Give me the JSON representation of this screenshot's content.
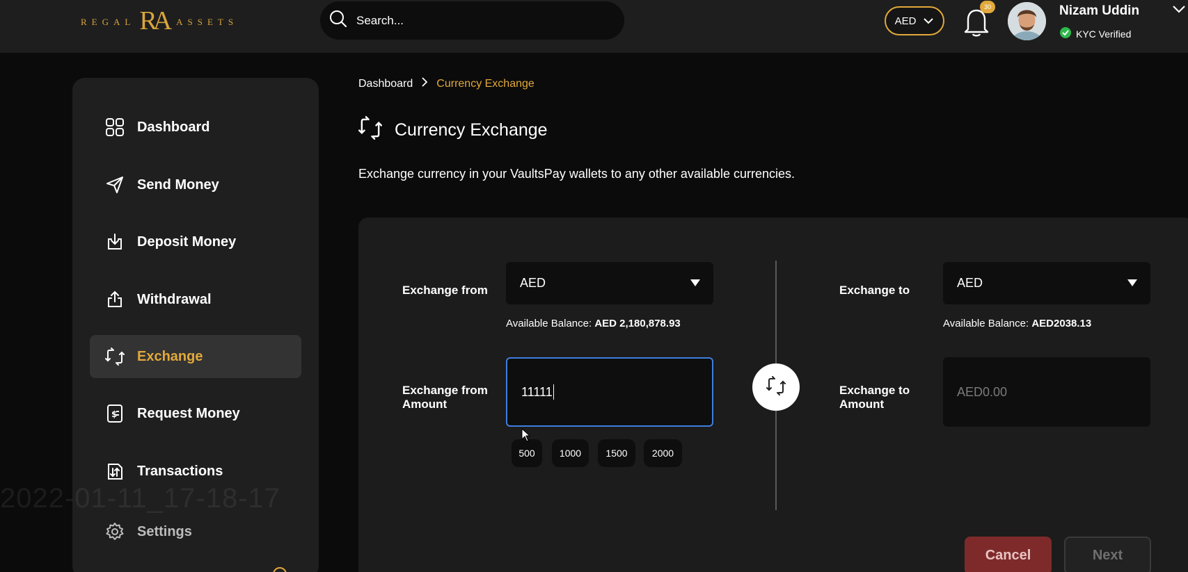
{
  "brand": {
    "logo_left": "REGAL",
    "logo_mono": "RA",
    "logo_right": "ASSETS"
  },
  "search": {
    "placeholder": "Search..."
  },
  "header": {
    "currency": "AED",
    "notifications_count": "30",
    "user_name": "Nizam Uddin",
    "kyc_status": "KYC Verified"
  },
  "sidebar": {
    "items": [
      {
        "label": "Dashboard",
        "icon": "grid-icon"
      },
      {
        "label": "Send Money",
        "icon": "send-icon"
      },
      {
        "label": "Deposit Money",
        "icon": "deposit-icon"
      },
      {
        "label": "Withdrawal",
        "icon": "withdraw-icon"
      },
      {
        "label": "Exchange",
        "icon": "exchange-icon",
        "active": true
      },
      {
        "label": "Request Money",
        "icon": "request-money-icon"
      },
      {
        "label": "Transactions",
        "icon": "transactions-icon"
      },
      {
        "label": "Settings",
        "icon": "gear-icon"
      }
    ],
    "watermark": "2022-01-11_17-18-17"
  },
  "breadcrumb": {
    "home": "Dashboard",
    "current": "Currency Exchange"
  },
  "page": {
    "title": "Currency Exchange",
    "subtitle": "Exchange currency in your VaultsPay wallets to any other available currencies."
  },
  "exchange": {
    "from_label": "Exchange from",
    "from_currency": "AED",
    "from_balance_label": "Available Balance:",
    "from_balance_value": "AED 2,180,878.93",
    "from_amount_label": "Exchange from Amount",
    "from_amount_value": "11111",
    "quick_amounts": [
      "500",
      "1000",
      "1500",
      "2000"
    ],
    "to_label": "Exchange to",
    "to_currency": "AED",
    "to_balance_label": "Available Balance:",
    "to_balance_value": "AED2038.13",
    "to_amount_label": "Exchange to Amount",
    "to_amount_placeholder": "AED0.00"
  },
  "actions": {
    "cancel": "Cancel",
    "next": "Next"
  },
  "colors": {
    "accent": "#e2a93b",
    "focus": "#3d7fe0",
    "cancel": "#7f2a2a"
  }
}
